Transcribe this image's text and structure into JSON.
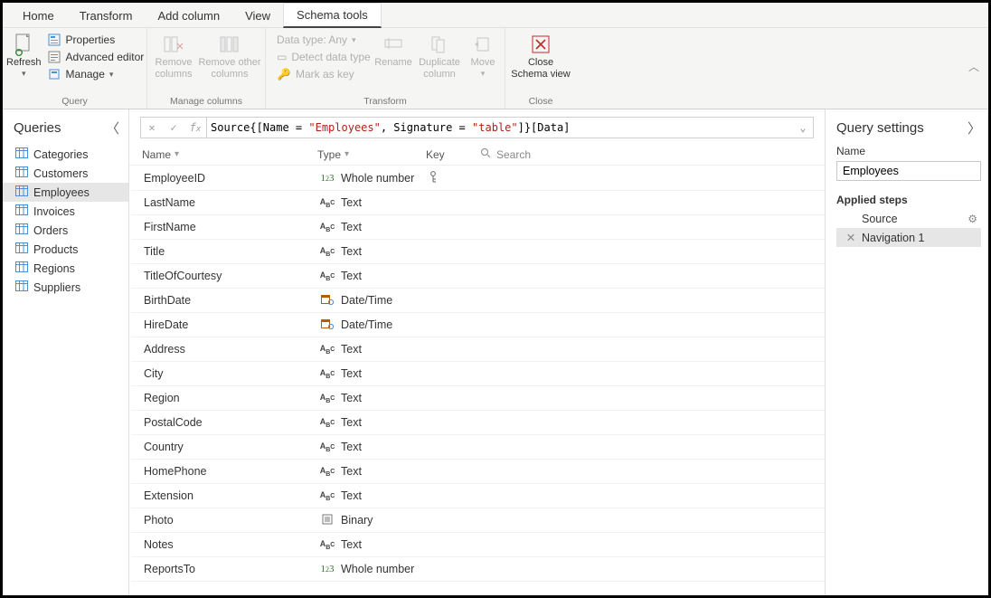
{
  "tabs": {
    "items": [
      "Home",
      "Transform",
      "Add column",
      "View",
      "Schema tools"
    ],
    "active_index": 4
  },
  "ribbon": {
    "query": {
      "label": "Query",
      "refresh": "Refresh",
      "properties": "Properties",
      "advanced_editor": "Advanced editor",
      "manage": "Manage"
    },
    "manage_columns": {
      "label": "Manage columns",
      "remove_columns": "Remove columns",
      "remove_other_columns": "Remove other columns"
    },
    "transform": {
      "label": "Transform",
      "data_type": "Data type: Any",
      "detect_data_type": "Detect data type",
      "mark_as_key": "Mark as key",
      "rename": "Rename",
      "duplicate_column": "Duplicate column",
      "move": "Move"
    },
    "close": {
      "label": "Close",
      "close_schema_view": "Close Schema view"
    }
  },
  "formula": {
    "prefix": "Source{[Name = ",
    "str1": "\"Employees\"",
    "mid": ", Signature = ",
    "str2": "\"table\"",
    "suffix": "]}[Data]"
  },
  "queries": {
    "title": "Queries",
    "items": [
      "Categories",
      "Customers",
      "Employees",
      "Invoices",
      "Orders",
      "Products",
      "Regions",
      "Suppliers"
    ],
    "selected_index": 2
  },
  "schema": {
    "headers": {
      "name": "Name",
      "type": "Type",
      "key": "Key",
      "search": "Search"
    },
    "rows": [
      {
        "name": "EmployeeID",
        "type": "Whole number",
        "type_kind": "num",
        "key": true
      },
      {
        "name": "LastName",
        "type": "Text",
        "type_kind": "text",
        "key": false
      },
      {
        "name": "FirstName",
        "type": "Text",
        "type_kind": "text",
        "key": false
      },
      {
        "name": "Title",
        "type": "Text",
        "type_kind": "text",
        "key": false
      },
      {
        "name": "TitleOfCourtesy",
        "type": "Text",
        "type_kind": "text",
        "key": false
      },
      {
        "name": "BirthDate",
        "type": "Date/Time",
        "type_kind": "date",
        "key": false
      },
      {
        "name": "HireDate",
        "type": "Date/Time",
        "type_kind": "date",
        "key": false
      },
      {
        "name": "Address",
        "type": "Text",
        "type_kind": "text",
        "key": false
      },
      {
        "name": "City",
        "type": "Text",
        "type_kind": "text",
        "key": false
      },
      {
        "name": "Region",
        "type": "Text",
        "type_kind": "text",
        "key": false
      },
      {
        "name": "PostalCode",
        "type": "Text",
        "type_kind": "text",
        "key": false
      },
      {
        "name": "Country",
        "type": "Text",
        "type_kind": "text",
        "key": false
      },
      {
        "name": "HomePhone",
        "type": "Text",
        "type_kind": "text",
        "key": false
      },
      {
        "name": "Extension",
        "type": "Text",
        "type_kind": "text",
        "key": false
      },
      {
        "name": "Photo",
        "type": "Binary",
        "type_kind": "bin",
        "key": false
      },
      {
        "name": "Notes",
        "type": "Text",
        "type_kind": "text",
        "key": false
      },
      {
        "name": "ReportsTo",
        "type": "Whole number",
        "type_kind": "num",
        "key": false
      }
    ]
  },
  "settings": {
    "title": "Query settings",
    "name_label": "Name",
    "name_value": "Employees",
    "applied_steps_label": "Applied steps",
    "steps": [
      {
        "label": "Source",
        "deletable": false,
        "gear": true,
        "selected": false
      },
      {
        "label": "Navigation 1",
        "deletable": true,
        "gear": false,
        "selected": true
      }
    ]
  }
}
